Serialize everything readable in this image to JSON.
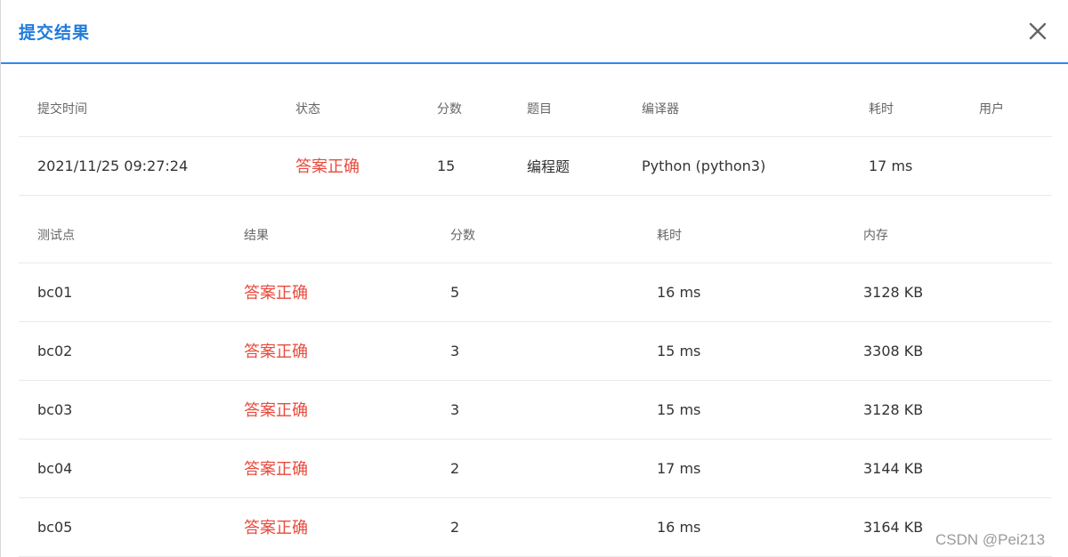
{
  "dialog": {
    "title": "提交结果"
  },
  "summary": {
    "headers": [
      "提交时间",
      "状态",
      "分数",
      "题目",
      "编译器",
      "耗时",
      "用户"
    ],
    "row": [
      "2021/11/25 09:27:24",
      "答案正确",
      "15",
      "编程题",
      "Python (python3)",
      "17 ms",
      ""
    ]
  },
  "cases": {
    "headers": [
      "测试点",
      "结果",
      "分数",
      "耗时",
      "内存"
    ],
    "rows": [
      [
        "bc01",
        "答案正确",
        "5",
        "16 ms",
        "3128 KB"
      ],
      [
        "bc02",
        "答案正确",
        "3",
        "15 ms",
        "3308 KB"
      ],
      [
        "bc03",
        "答案正确",
        "3",
        "15 ms",
        "3128 KB"
      ],
      [
        "bc04",
        "答案正确",
        "2",
        "17 ms",
        "3144 KB"
      ],
      [
        "bc05",
        "答案正确",
        "2",
        "16 ms",
        "3164 KB"
      ]
    ]
  },
  "watermark": "CSDN @Pei213",
  "colors": {
    "accent": "#2d8cf0",
    "title": "#1f7bdc",
    "status_ok": "#e84a3c"
  }
}
